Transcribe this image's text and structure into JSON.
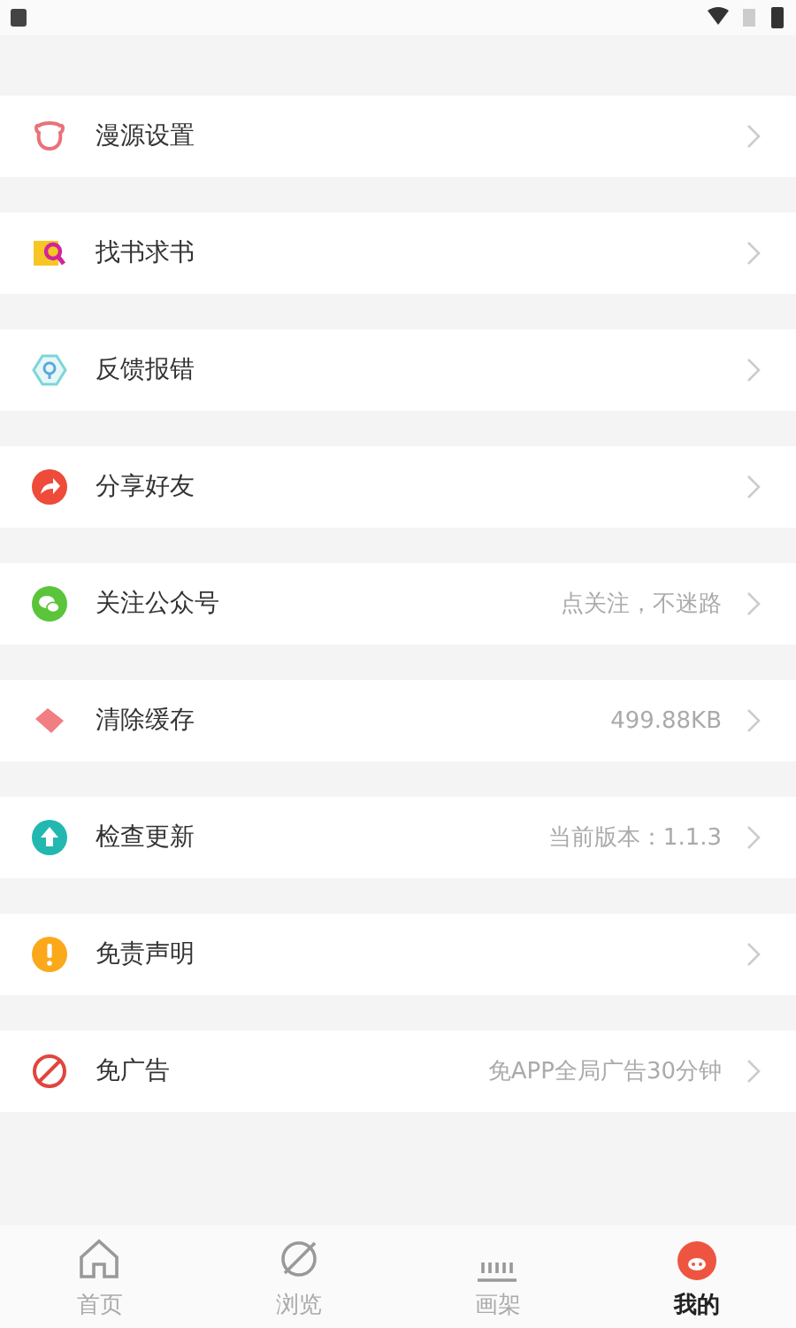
{
  "menu": [
    {
      "label": "漫源设置"
    },
    {
      "label": "找书求书"
    },
    {
      "label": "反馈报错"
    },
    {
      "label": "分享好友"
    },
    {
      "label": "关注公众号",
      "value": "点关注，不迷路"
    },
    {
      "label": "清除缓存",
      "value": "499.88KB"
    },
    {
      "label": "检查更新",
      "value": "当前版本：1.1.3"
    },
    {
      "label": "免责声明"
    },
    {
      "label": "免广告",
      "value": "免APP全局广告30分钟"
    }
  ],
  "tabs": [
    {
      "label": "首页",
      "selected": false
    },
    {
      "label": "浏览",
      "selected": false
    },
    {
      "label": "画架",
      "selected": false
    },
    {
      "label": "我的",
      "selected": true
    }
  ]
}
